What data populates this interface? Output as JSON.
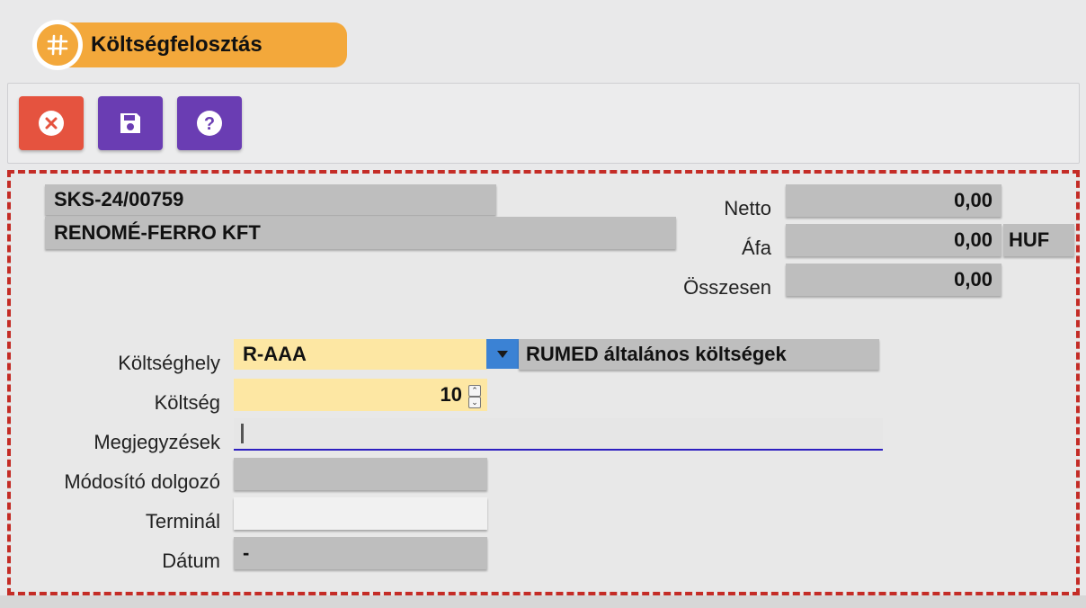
{
  "header": {
    "title": "Költségfelosztás",
    "icon": "hash-icon",
    "accent": "#f3a83b"
  },
  "toolbar": {
    "buttons": [
      {
        "name": "cancel",
        "icon": "close-circle-icon",
        "color": "#e5533f"
      },
      {
        "name": "save",
        "icon": "floppy-disk-icon",
        "color": "#6a3db3"
      },
      {
        "name": "help",
        "icon": "question-circle-icon",
        "color": "#6a3db3"
      }
    ]
  },
  "document": {
    "number": "SKS-24/00759",
    "partner": "RENOMÉ-FERRO KFT"
  },
  "totals": {
    "netto_label": "Netto",
    "netto_value": "0,00",
    "afa_label": "Áfa",
    "afa_value": "0,00",
    "currency": "HUF",
    "osszesen_label": "Összesen",
    "osszesen_value": "0,00"
  },
  "form": {
    "koltseghely_label": "Költséghely",
    "koltseghely_code": "R-AAA",
    "koltseghely_name": "RUMED általános költségek",
    "koltseg_label": "Költség",
    "koltseg_value": "10",
    "megjegyzesek_label": "Megjegyzések",
    "megjegyzesek_value": "",
    "modosito_label": "Módosító dolgozó",
    "modosito_value": "",
    "terminal_label": "Terminál",
    "terminal_value": "",
    "datum_label": "Dátum",
    "datum_value": "-"
  }
}
